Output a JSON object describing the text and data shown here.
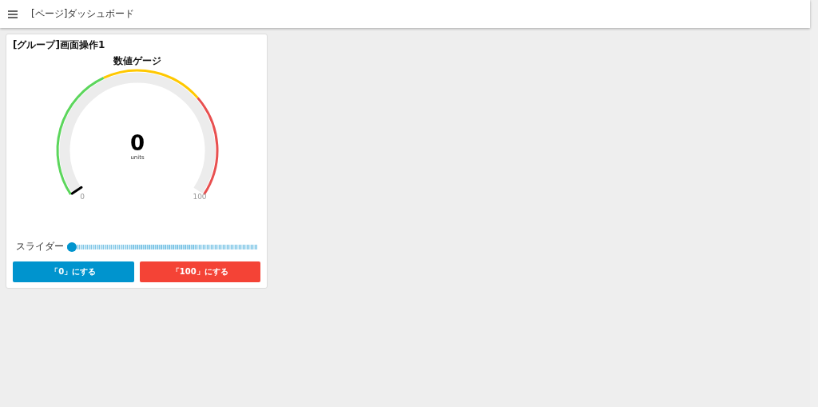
{
  "header": {
    "title": "[ページ]ダッシュボード"
  },
  "group": {
    "title": "[グループ]画面操作1",
    "gauge": {
      "title": "数値ゲージ",
      "value": "0",
      "units": "units",
      "min": "0",
      "max": "100",
      "level": 0
    },
    "slider": {
      "label": "スライダー",
      "level": 0
    },
    "buttons": [
      {
        "label": "「0」にする",
        "color": "#0094ce"
      },
      {
        "label": "「100」にする",
        "color": "#f44336"
      }
    ]
  }
}
